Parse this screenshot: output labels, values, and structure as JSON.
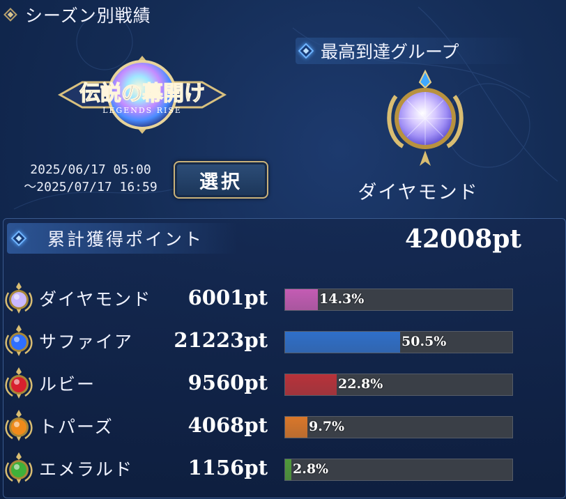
{
  "header": {
    "title": "シーズン別戦績"
  },
  "season": {
    "logo_text": "伝説の幕開け",
    "logo_subtext": "LEGENDS RISE",
    "date_start": "2025/06/17 05:00",
    "date_end": "〜2025/07/17 16:59",
    "select_label": "選択"
  },
  "group": {
    "title": "最高到達グループ",
    "name": "ダイヤモンド"
  },
  "total": {
    "label": "累計獲得ポイント",
    "value": "42008pt"
  },
  "rows": [
    {
      "name": "ダイヤモンド",
      "points": "6001pt",
      "percent_label": "14.3%",
      "percent": 14.3,
      "color": "#c45cb4",
      "icon": "diamond-gem-icon",
      "gem": "#c9b8ff"
    },
    {
      "name": "サファイア",
      "points": "21223pt",
      "percent_label": "50.5%",
      "percent": 50.5,
      "color": "#2f6fc9",
      "icon": "sapphire-gem-icon",
      "gem": "#2f6fff"
    },
    {
      "name": "ルビー",
      "points": "9560pt",
      "percent_label": "22.8%",
      "percent": 22.8,
      "color": "#b8323a",
      "icon": "ruby-gem-icon",
      "gem": "#d8202e"
    },
    {
      "name": "トパーズ",
      "points": "4068pt",
      "percent_label": "9.7%",
      "percent": 9.7,
      "color": "#d9772a",
      "icon": "topaz-gem-icon",
      "gem": "#f08a1a"
    },
    {
      "name": "エメラルド",
      "points": "1156pt",
      "percent_label": "2.8%",
      "percent": 2.8,
      "color": "#4f9a3a",
      "icon": "emerald-gem-icon",
      "gem": "#3fb03a"
    }
  ]
}
